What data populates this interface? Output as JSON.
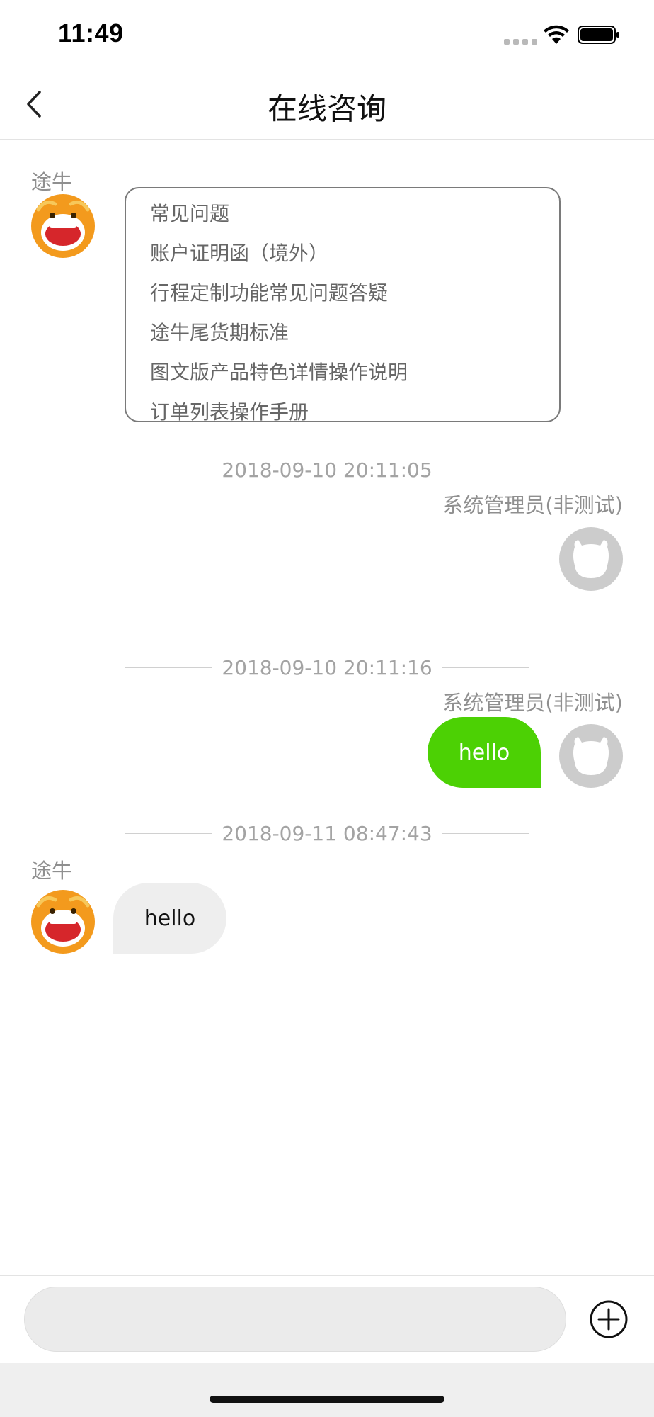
{
  "status_bar": {
    "time": "11:49"
  },
  "nav": {
    "title": "在线咨询"
  },
  "messages": {
    "faq_sender": "途牛",
    "faq_items": [
      "常见问题",
      "账户证明函（境外）",
      "行程定制功能常见问题答疑",
      "途牛尾货期标准",
      "图文版产品特色详情操作说明",
      "订单列表操作手册"
    ],
    "ts1": "2018-09-10 20:11:05",
    "admin_name_1": "系统管理员(非测试)",
    "ts2": "2018-09-10 20:11:16",
    "admin_name_2": "系统管理员(非测试)",
    "admin_message": "hello",
    "ts3": "2018-09-11 08:47:43",
    "reply_sender": "途牛",
    "reply_message": "hello"
  },
  "input": {
    "placeholder": ""
  },
  "colors": {
    "sent_bubble": "#4cd104",
    "received_bubble": "#eeeeee",
    "avatar_orange": "#f39a1d"
  }
}
